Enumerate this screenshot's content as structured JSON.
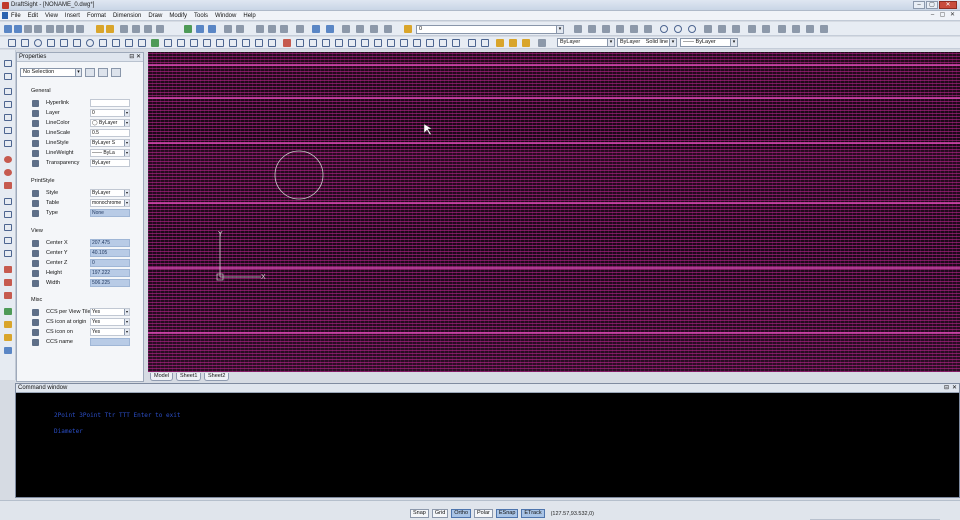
{
  "titlebar": {
    "title": "DraftSight - [NONAME_0.dwg*]",
    "minimize": "–",
    "maximize": "▢",
    "close": "✕"
  },
  "menu": [
    "File",
    "Edit",
    "View",
    "Insert",
    "Format",
    "Dimension",
    "Draw",
    "Modify",
    "Tools",
    "Window",
    "Help"
  ],
  "doc_controls": [
    "–",
    "▢",
    "✕"
  ],
  "toolbar": {
    "layer_combo": "0",
    "linecolor_combo": "ByLayer",
    "linestyle_combo": "ByLayer",
    "linestyle_name": "Solid line",
    "lineweight_combo": "—— ByLayer",
    "combo_arrow": "▾"
  },
  "properties": {
    "title": "Properties",
    "pin": "⊟",
    "close": "✕",
    "selection": "No Selection",
    "dropdown_arrow": "▾",
    "sections": {
      "general": "General",
      "printstyle": "PrintStyle",
      "view": "View",
      "misc": "Misc"
    },
    "general": [
      {
        "label": "Hyperlink",
        "value": ""
      },
      {
        "label": "Layer",
        "value": "0"
      },
      {
        "label": "LineColor",
        "value": "◯ ByLayer"
      },
      {
        "label": "LineScale",
        "value": "0.5"
      },
      {
        "label": "LineStyle",
        "value": "ByLayer     S"
      },
      {
        "label": "LineWeight",
        "value": "—— ByLa"
      },
      {
        "label": "Transparency",
        "value": "ByLayer"
      }
    ],
    "printstyle": [
      {
        "label": "Style",
        "value": "ByLayer"
      },
      {
        "label": "Table",
        "value": "monochrome"
      },
      {
        "label": "Type",
        "value": "None"
      }
    ],
    "view": [
      {
        "label": "Center X",
        "value": "207.475"
      },
      {
        "label": "Center Y",
        "value": "40.105"
      },
      {
        "label": "Center Z",
        "value": "0"
      },
      {
        "label": "Height",
        "value": "197.222"
      },
      {
        "label": "Width",
        "value": "506.225"
      }
    ],
    "misc": [
      {
        "label": "CCS per View Tile",
        "value": "Yes"
      },
      {
        "label": "CS icon at origin",
        "value": "Yes"
      },
      {
        "label": "CS icon on",
        "value": "Yes"
      },
      {
        "label": "CCS name",
        "value": ""
      }
    ]
  },
  "canvas": {
    "ucs_x": "X",
    "ucs_y": "Y"
  },
  "sheet_tabs": [
    "Model",
    "Sheet1",
    "Sheet2"
  ],
  "command_window": {
    "title": "Command window",
    "buttons": [
      "⊟",
      "✕"
    ],
    "lines": [
      "2Point  3Point  Ttr  TTT  Enter to exit",
      "Diameter"
    ]
  },
  "status_buttons": [
    {
      "label": "Snap",
      "on": false
    },
    {
      "label": "Grid",
      "on": false
    },
    {
      "label": "Ortho",
      "on": true
    },
    {
      "label": "Polar",
      "on": false
    },
    {
      "label": "ESnap",
      "on": true
    },
    {
      "label": "ETrack",
      "on": true
    }
  ],
  "coordinates": "(127.57,93.532,0)",
  "colors": {
    "canvas_bg": "#1a0714",
    "accent": "#a9c4e6",
    "command_text": "#2b4ec6"
  }
}
